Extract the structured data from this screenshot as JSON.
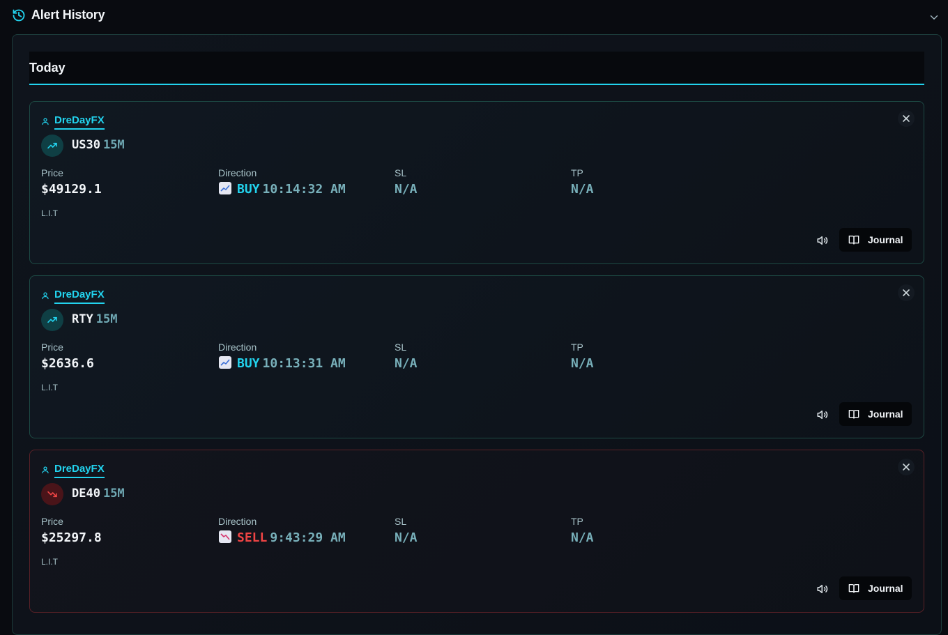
{
  "header": {
    "title": "Alert History",
    "icon": "history-icon",
    "collapse_icon": "chevron-down-icon"
  },
  "section": {
    "label": "Today"
  },
  "colors": {
    "accent": "#22d3ee",
    "sell": "#ef4444",
    "background": "#090b10"
  },
  "alerts": [
    {
      "author": "DreDayFX",
      "symbol": "US30",
      "timeframe": "15M",
      "price_label": "Price",
      "price": "$49129.1",
      "direction_label": "Direction",
      "direction": "BUY",
      "time": "10:14:32 AM",
      "sl_label": "SL",
      "sl": "N/A",
      "tp_label": "TP",
      "tp": "N/A",
      "source": "L.I.T",
      "journal_label": "Journal",
      "trend_icon": "trending-up-icon"
    },
    {
      "author": "DreDayFX",
      "symbol": "RTY",
      "timeframe": "15M",
      "price_label": "Price",
      "price": "$2636.6",
      "direction_label": "Direction",
      "direction": "BUY",
      "time": "10:13:31 AM",
      "sl_label": "SL",
      "sl": "N/A",
      "tp_label": "TP",
      "tp": "N/A",
      "source": "L.I.T",
      "journal_label": "Journal",
      "trend_icon": "trending-up-icon"
    },
    {
      "author": "DreDayFX",
      "symbol": "DE40",
      "timeframe": "15M",
      "price_label": "Price",
      "price": "$25297.8",
      "direction_label": "Direction",
      "direction": "SELL",
      "time": "9:43:29 AM",
      "sl_label": "SL",
      "sl": "N/A",
      "tp_label": "TP",
      "tp": "N/A",
      "source": "L.I.T",
      "journal_label": "Journal",
      "trend_icon": "trending-down-icon"
    }
  ]
}
